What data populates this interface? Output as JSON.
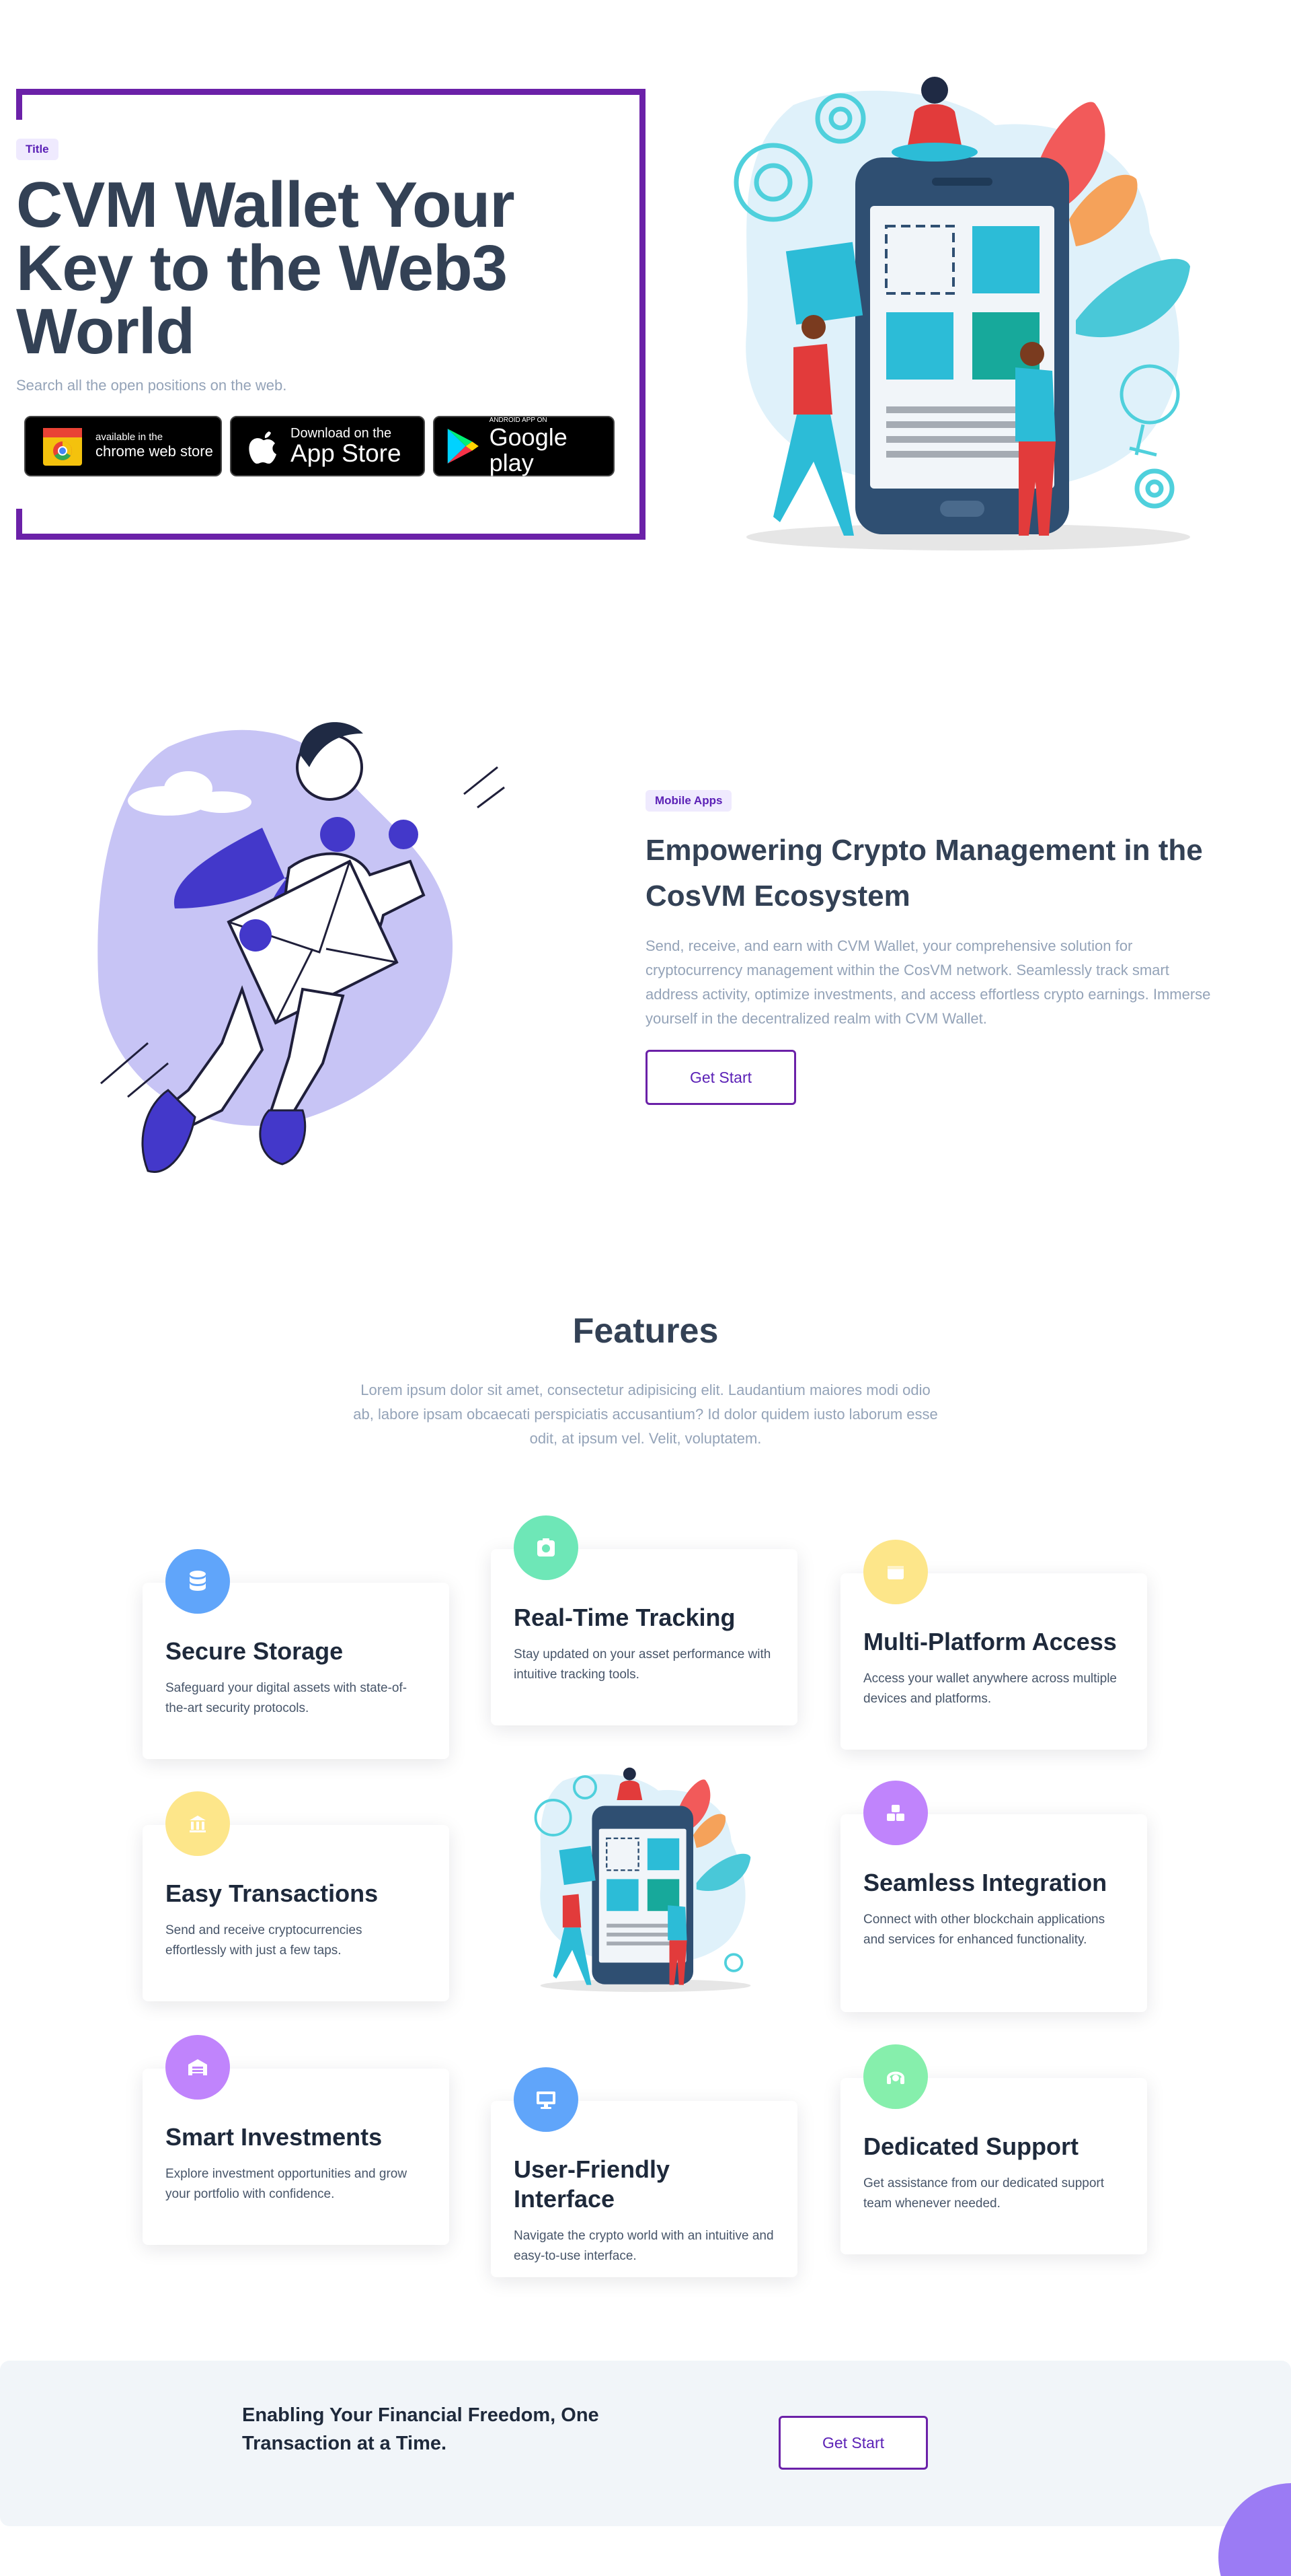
{
  "hero": {
    "tag": "Title",
    "title": "CVM Wallet Your Key to the Web3 World",
    "subtitle": "Search all the open positions on the web.",
    "stores": {
      "chrome_small": "available in the",
      "chrome_big": "chrome web store",
      "apple_small": "Download on the",
      "apple_big": "App Store",
      "google_small": "ANDROID APP ON",
      "google_big": "Google play"
    }
  },
  "ecosystem": {
    "tag": "Mobile Apps",
    "title": "Empowering Crypto Management in the CosVM Ecosystem",
    "text": "Send, receive, and earn with CVM Wallet, your comprehensive solution for cryptocurrency management within the CosVM network. Seamlessly track smart address activity, optimize investments, and access effortless crypto earnings. Immerse yourself in the decentralized realm with CVM Wallet.",
    "button": "Get Start"
  },
  "features": {
    "title": "Features",
    "description": "Lorem ipsum dolor sit amet, consectetur adipisicing elit. Laudantium maiores modi odio ab, labore ipsam obcaecati perspiciatis accusantium? Id dolor quidem iusto laborum esse odit, at ipsum vel. Velit, voluptatem.",
    "items": [
      {
        "title": "Secure Storage",
        "text": "Safeguard your digital assets with state-of-the-art security protocols.",
        "icon": "database-icon",
        "color": "#60a5fa"
      },
      {
        "title": "Real-Time Tracking",
        "text": "Stay updated on your asset performance with intuitive tracking tools.",
        "icon": "camera-icon",
        "color": "#6ee7b7"
      },
      {
        "title": "Multi-Platform Access",
        "text": "Access your wallet anywhere across multiple devices and platforms.",
        "icon": "wallet-icon",
        "color": "#fde68a"
      },
      {
        "title": "Easy Transactions",
        "text": "Send and receive cryptocurrencies effortlessly with just a few taps.",
        "icon": "bank-icon",
        "color": "#fde68a"
      },
      {
        "title": "Seamless Integration",
        "text": "Connect with other blockchain applications and services for enhanced functionality.",
        "icon": "cubes-icon",
        "color": "#c084fc"
      },
      {
        "title": "Smart Investments",
        "text": "Explore investment opportunities and grow your portfolio with confidence.",
        "icon": "warehouse-icon",
        "color": "#c084fc"
      },
      {
        "title": "User-Friendly Interface",
        "text": "Navigate the crypto world with an intuitive and easy-to-use interface.",
        "icon": "monitor-icon",
        "color": "#60a5fa"
      },
      {
        "title": "Dedicated Support",
        "text": "Get assistance from our dedicated support team whenever needed.",
        "icon": "headset-icon",
        "color": "#86efac"
      }
    ]
  },
  "cta": {
    "text": "Enabling Your Financial Freedom, One Transaction at a Time.",
    "button": "Get Start"
  }
}
